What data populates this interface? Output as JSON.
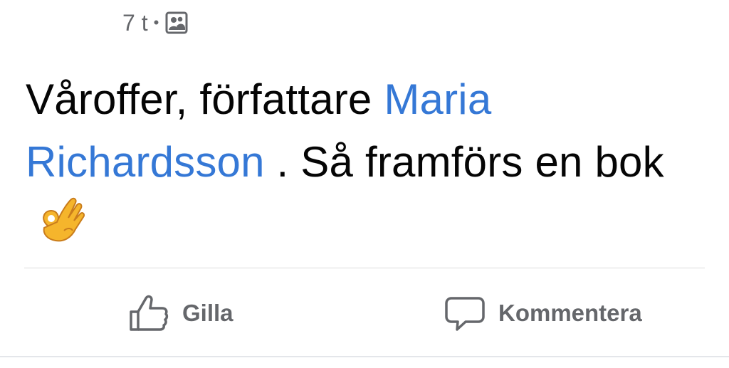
{
  "post": {
    "time": "7 t",
    "separator": "•",
    "audience_icon": "friends-photo-icon",
    "text_before": "Våroffer, författare ",
    "mention": "Maria Richardsson",
    "text_after": " . Så framförs en bok ",
    "emoji": "ok-hand-icon"
  },
  "actions": {
    "like_label": "Gilla",
    "comment_label": "Kommentera"
  },
  "colors": {
    "link": "#3578d6",
    "secondary_text": "#65676b",
    "divider": "#dcdcdc"
  }
}
